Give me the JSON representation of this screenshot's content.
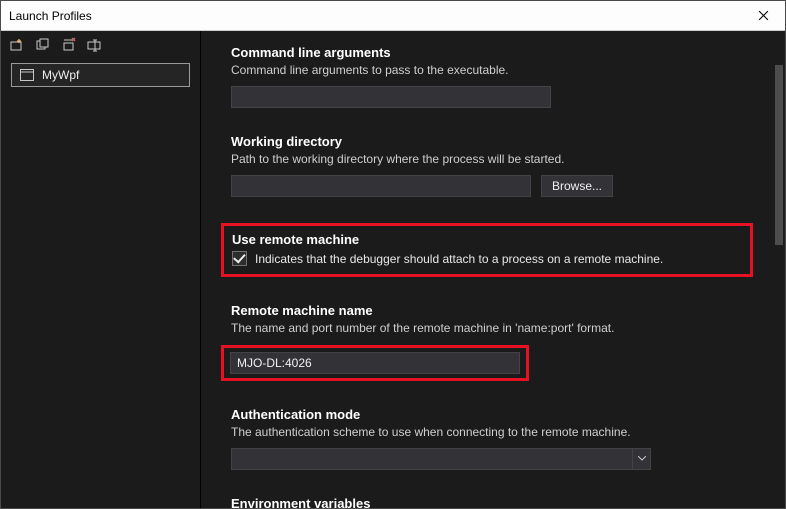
{
  "window": {
    "title": "Launch Profiles"
  },
  "sidebar": {
    "profiles": [
      {
        "label": "MyWpf"
      }
    ]
  },
  "sections": {
    "cmdArgs": {
      "title": "Command line arguments",
      "desc": "Command line arguments to pass to the executable.",
      "value": ""
    },
    "workingDir": {
      "title": "Working directory",
      "desc": "Path to the working directory where the process will be started.",
      "value": "",
      "browse": "Browse..."
    },
    "useRemote": {
      "title": "Use remote machine",
      "checkLabel": "Indicates that the debugger should attach to a process on a remote machine.",
      "checked": true
    },
    "remoteName": {
      "title": "Remote machine name",
      "desc": "The name and port number of the remote machine in 'name:port' format.",
      "value": "MJO-DL:4026"
    },
    "authMode": {
      "title": "Authentication mode",
      "desc": "The authentication scheme to use when connecting to the remote machine.",
      "value": ""
    },
    "envVars": {
      "title": "Environment variables"
    }
  }
}
